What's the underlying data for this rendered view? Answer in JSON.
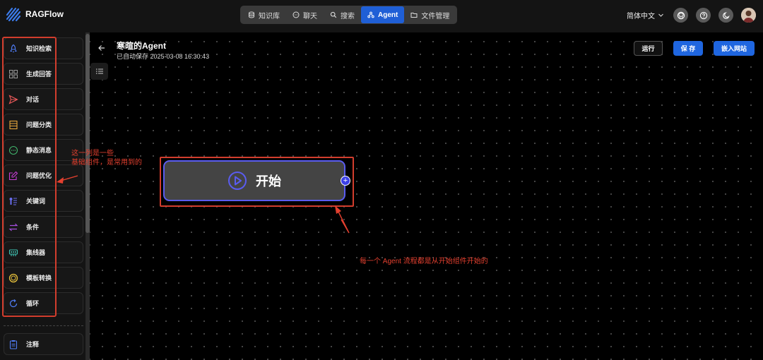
{
  "app": {
    "name": "RAGFlow"
  },
  "nav": {
    "tabs": [
      {
        "label": "知识库",
        "icon": "database-icon"
      },
      {
        "label": "聊天",
        "icon": "chat-icon"
      },
      {
        "label": "搜索",
        "icon": "search-icon"
      },
      {
        "label": "Agent",
        "icon": "agent-icon",
        "active": true
      },
      {
        "label": "文件管理",
        "icon": "folder-icon"
      }
    ]
  },
  "header": {
    "language": "简体中文"
  },
  "sidebar": {
    "items": [
      {
        "label": "知识检索",
        "icon": "rocket-icon",
        "color": "#4f7cf5"
      },
      {
        "label": "生成回答",
        "icon": "layout-icon",
        "color": "#9a9a9a"
      },
      {
        "label": "对话",
        "icon": "send-icon",
        "color": "#ef5a5a"
      },
      {
        "label": "问题分类",
        "icon": "list-box-icon",
        "color": "#e8a73c"
      },
      {
        "label": "静态消息",
        "icon": "message-dots-icon",
        "color": "#41b36b"
      },
      {
        "label": "问题优化",
        "icon": "edit-icon",
        "color": "#c93fd6"
      },
      {
        "label": "关键词",
        "icon": "keyword-icon",
        "color": "#6a6ef0"
      },
      {
        "label": "条件",
        "icon": "swap-icon",
        "color": "#a64fe0"
      },
      {
        "label": "集线器",
        "icon": "hub-icon",
        "color": "#3fc2b2"
      },
      {
        "label": "模板转换",
        "icon": "template-icon",
        "color": "#e8c23c"
      },
      {
        "label": "循环",
        "icon": "loop-icon",
        "color": "#4f7cf5"
      }
    ],
    "note": {
      "label": "注释",
      "icon": "note-icon",
      "color": "#4f7cf5"
    }
  },
  "page": {
    "title": "寒暄的Agent",
    "autosave": "已自动保存 2025-03-08 16:30:43"
  },
  "toolbar": {
    "run_label": "运行",
    "save_label": "保 存",
    "embed_label": "嵌入网站"
  },
  "canvas": {
    "start_node_label": "开始"
  },
  "annotations": {
    "sidebar_note_line1": "这一列是一些",
    "sidebar_note_line2": "基础组件，是常用到的",
    "node_note": "每一个 Agent 流程都是从开始组件开始的"
  },
  "colors": {
    "accent": "#1f66e0",
    "annotation": "#e4402f",
    "node_border": "#5a5cf0"
  }
}
